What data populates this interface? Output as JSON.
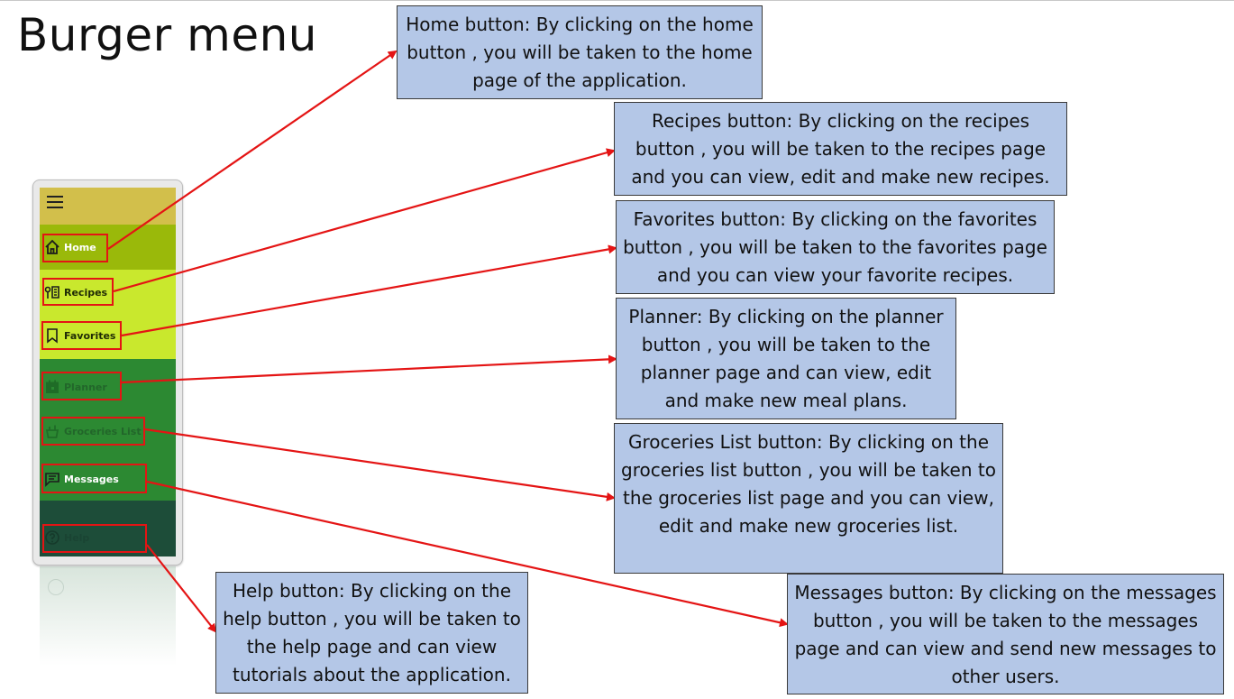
{
  "title": "Burger menu",
  "menu": {
    "items": [
      {
        "label": "Home",
        "icon": "home-icon"
      },
      {
        "label": "Recipes",
        "icon": "recipes-icon"
      },
      {
        "label": "Favorites",
        "icon": "bookmark-icon"
      },
      {
        "label": "Planner",
        "icon": "calendar-icon"
      },
      {
        "label": "Groceries List",
        "icon": "grocery-bag-icon"
      },
      {
        "label": "Messages",
        "icon": "message-icon"
      },
      {
        "label": "Help",
        "icon": "help-icon"
      }
    ]
  },
  "annotations": {
    "home": "Home button: By clicking on the home button , you will be taken to the home page of the application.",
    "recipes": "Recipes button: By clicking on the recipes button , you will be taken to the recipes page and you can view, edit and make new recipes.",
    "favorites": "Favorites button: By clicking on the favorites button , you will be taken to the favorites page and you can view your favorite recipes.",
    "planner": "Planner: By clicking on the planner button , you will be taken to the planner page and can view, edit and make new meal plans.",
    "groceries": "Groceries List button: By clicking on the groceries list button , you will be taken to the groceries list page and you can view, edit and make new groceries list.",
    "messages": "Messages button: By clicking on the messages button , you will be taken to the messages page and can view and send new messages to other users.",
    "help": "Help button: By clicking on the help button , you will be taken to the help page and can view tutorials about the application."
  },
  "colors": {
    "callout_fill": "#b4c7e7",
    "arrow": "#e41414",
    "menu_top": "#d2bf4b",
    "menu_home": "#9ab90a",
    "menu_lime": "#c9e82d",
    "menu_green": "#2c8932",
    "menu_dark": "#1d4d39"
  }
}
